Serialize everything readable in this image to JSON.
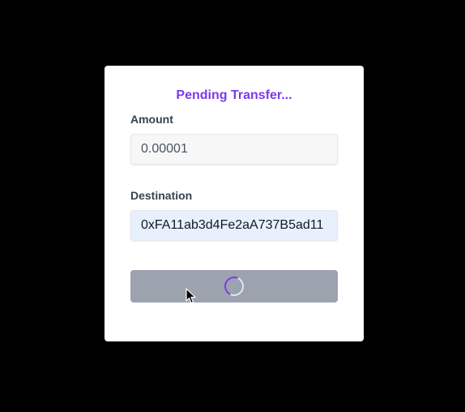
{
  "form": {
    "title": "Pending Transfer...",
    "amount_label": "Amount",
    "amount_value": "0.00001",
    "destination_label": "Destination",
    "destination_value": "0xFA11ab3d4Fe2aA737B5ad11",
    "submit_state": "loading"
  },
  "colors": {
    "accent": "#7c3aed",
    "button_disabled": "#9ca3af",
    "autofill_bg": "#e8f0fe"
  },
  "icons": {
    "spinner": "loading-spinner-icon",
    "cursor": "mouse-pointer-icon"
  }
}
